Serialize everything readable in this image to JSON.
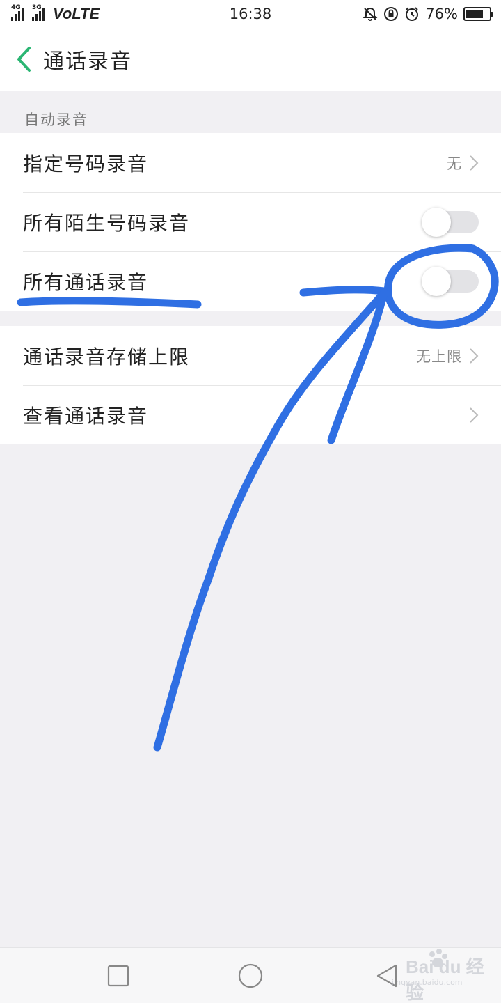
{
  "statusbar": {
    "network_1": "4G",
    "network_2": "3G",
    "volte": "VoLTE",
    "time": "16:38",
    "icons": [
      "bell-off-icon",
      "lock-rotation-icon",
      "alarm-icon"
    ],
    "battery_percent": "76%",
    "battery_level": 0.76
  },
  "header": {
    "title": "通话录音",
    "back_icon": "chevron-left-icon",
    "accent_color": "#2bb673"
  },
  "auto_record": {
    "section_label": "自动录音",
    "rows": [
      {
        "label": "指定号码录音",
        "value": "无",
        "type": "link"
      },
      {
        "label": "所有陌生号码录音",
        "type": "toggle",
        "on": false
      },
      {
        "label": "所有通话录音",
        "type": "toggle",
        "on": false
      }
    ]
  },
  "other_rows": [
    {
      "label": "通话录音存储上限",
      "value": "无上限",
      "type": "link"
    },
    {
      "label": "查看通话录音",
      "type": "link"
    }
  ],
  "navbar": {
    "buttons": [
      "recent-apps-icon",
      "home-icon",
      "back-icon"
    ]
  },
  "watermark": {
    "text": "Bai du 经验",
    "url": "jingyan.baidu.com"
  },
  "annotation_color": "#2f6fe3"
}
